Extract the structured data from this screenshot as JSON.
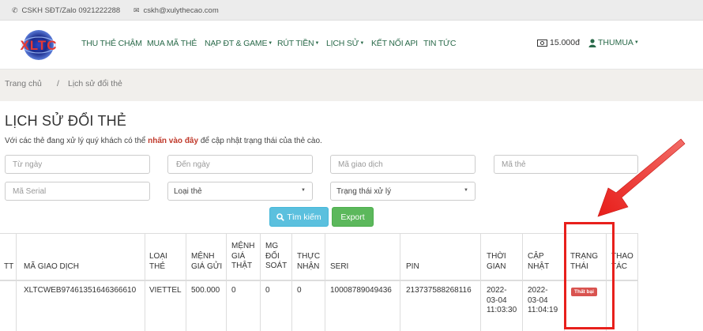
{
  "topbar": {
    "phone": "CSKH SĐT/Zalo 0921222288",
    "email": "cskh@xulythecao.com"
  },
  "logo": {
    "text": "XLTC"
  },
  "nav": {
    "items": [
      {
        "label": "THU THẺ CHẬM",
        "caret": ""
      },
      {
        "label": "MUA MÃ THẺ",
        "caret": ""
      },
      {
        "label": "NẠP ĐT & GAME",
        "caret": "▼"
      },
      {
        "label": "RÚT TIỀN",
        "caret": "▼"
      },
      {
        "label": "LỊCH SỬ",
        "caret": "▼"
      },
      {
        "label": "KẾT NỐI API",
        "caret": ""
      },
      {
        "label": "TIN TỨC",
        "caret": ""
      }
    ],
    "balance": "15.000đ",
    "user": "THUMUA",
    "user_caret": "▼"
  },
  "breadcrumb": {
    "home": "Trang chủ",
    "separator": "/",
    "current": "Lịch sử đổi thẻ"
  },
  "page": {
    "title": "LỊCH SỬ ĐỔI THẺ",
    "note_before": "Với các thẻ đang xử lý quý khách có thể ",
    "note_link": "nhấn vào đây",
    "note_after": " để cập nhật trạng thái của thẻ cào."
  },
  "filters": {
    "from_date": "Từ ngày",
    "to_date": "Đến ngày",
    "transaction_code": "Mã giao dịch",
    "card_code": "Mã thẻ",
    "serial": "Mã Serial",
    "card_type": "Loại thẻ",
    "status": "Trạng thái xử lý",
    "search_button": "Tìm kiếm",
    "export_button": "Export"
  },
  "table": {
    "headers": [
      [
        "TT"
      ],
      [
        "MÃ GIAO DỊCH"
      ],
      [
        "LOẠI",
        "THẺ"
      ],
      [
        "MỆNH",
        "GIÁ GỬI"
      ],
      [
        "MỆNH",
        "GIÁ",
        "THẬT"
      ],
      [
        "MG",
        "ĐỐI",
        "SOÁT"
      ],
      [
        "THỰC",
        "NHẬN"
      ],
      [
        "SERI"
      ],
      [
        "PIN"
      ],
      [
        "THỜI",
        "GIAN"
      ],
      [
        "CẬP",
        "NHẬT"
      ],
      [
        "TRẠNG",
        "THÁI"
      ],
      [
        "THAO",
        "TÁC"
      ]
    ],
    "rows": [
      {
        "transaction_code": "XLTCWEB97461351646366610",
        "card_type": "VIETTEL",
        "declared_value": "500.000",
        "real_value": "0",
        "checked_value": "0",
        "received": "0",
        "serial": "10008789049436",
        "pin": "213737588268116",
        "time": [
          "2022-",
          "03-04",
          "11:03:30"
        ],
        "updated": [
          "2022-",
          "03-04",
          "11:04:19"
        ],
        "status": "Thất bại"
      }
    ]
  },
  "colors": {
    "nav_text": "#2a6a4a",
    "search_button": "#5bc0de",
    "export_button": "#5cb85c",
    "status_failed": "#d9534f",
    "annotation": "#e8201c",
    "highlight_text": "#c0392b"
  }
}
